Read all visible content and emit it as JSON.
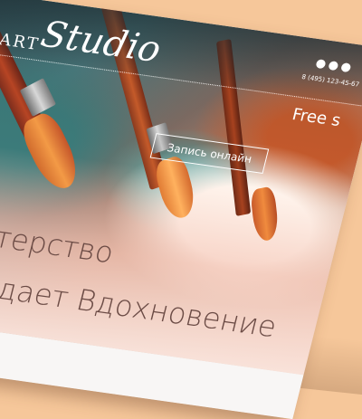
{
  "logo": {
    "prefix": "ART",
    "name": "Studio"
  },
  "header": {
    "phone": "8 (495) 123-45-67",
    "free_text": "Free s",
    "social_icons": [
      "social-icon-1",
      "social-icon-2",
      "social-icon-3"
    ]
  },
  "hero": {
    "cta_label": "Запись онлайн",
    "headline_line1": "Мастерство",
    "headline_line2": "рождает Вдохновение"
  },
  "colors": {
    "background": "#f6c79a",
    "headline": "#6b4b45",
    "header_text": "#ffffff"
  }
}
